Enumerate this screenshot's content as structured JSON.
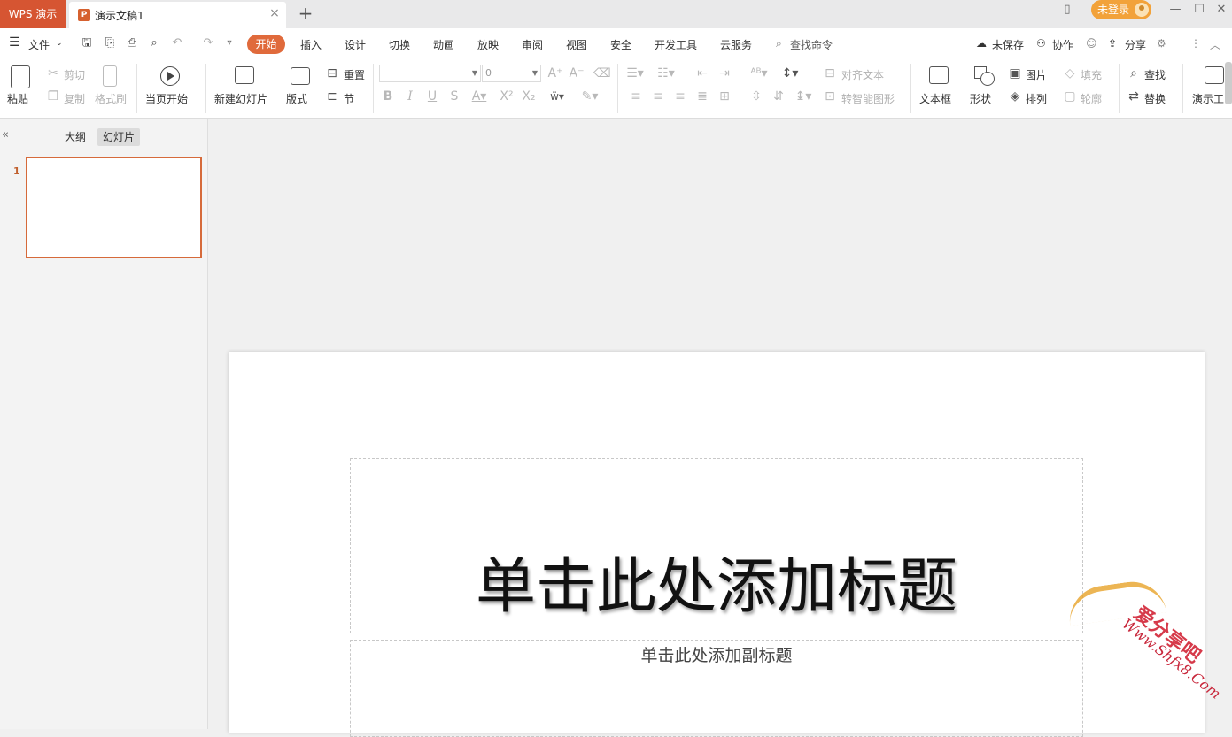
{
  "titlebar": {
    "app_name": "WPS 演示",
    "doc_title": "演示文稿1",
    "login": "未登录"
  },
  "menu": {
    "file": "文件",
    "tabs": [
      "开始",
      "插入",
      "设计",
      "切换",
      "动画",
      "放映",
      "审阅",
      "视图",
      "安全",
      "开发工具",
      "云服务"
    ],
    "search": "查找命令",
    "unsaved": "未保存",
    "collab": "协作",
    "share": "分享"
  },
  "ribbon": {
    "paste": "粘贴",
    "cut": "剪切",
    "copy": "复制",
    "format_painter": "格式刷",
    "play_from_current": "当页开始",
    "new_slide": "新建幻灯片",
    "layout": "版式",
    "reset": "重置",
    "section": "节",
    "font_size": "0",
    "align_text": "对齐文本",
    "smart_art": "转智能图形",
    "textbox": "文本框",
    "shape": "形状",
    "picture": "图片",
    "arrange": "排列",
    "fill": "填充",
    "outline": "轮廓",
    "find": "查找",
    "replace": "替换",
    "present_tools": "演示工"
  },
  "left_panel": {
    "tab_outline": "大纲",
    "tab_slides": "幻灯片",
    "slide_number": "1"
  },
  "slide": {
    "title_placeholder": "单击此处添加标题",
    "subtitle_placeholder": "单击此处添加副标题"
  },
  "watermark": {
    "cn": "爱分享吧",
    "en": "Www.Shfx8.Com"
  },
  "colors": {
    "accent": "#e06a3b",
    "app_tab": "#d65532",
    "login": "#f2a23a"
  }
}
